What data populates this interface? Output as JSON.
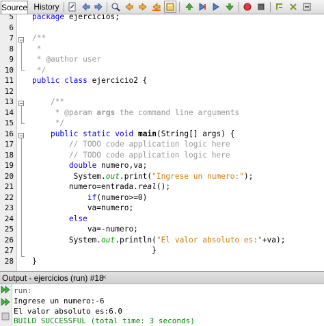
{
  "tabs": {
    "source": "Source",
    "history": "History"
  },
  "toolbar_icons": [
    "last-edit-icon",
    "back-icon",
    "forward-icon",
    "find-prev-icon",
    "find-next-icon",
    "find-selection-icon",
    "toggle-highlight-icon",
    "prev-bookmark-icon",
    "next-bookmark-icon",
    "toggle-bookmark-icon",
    "shift-left-icon",
    "shift-right-icon",
    "record-macro-icon"
  ],
  "editor": {
    "lines": [
      {
        "n": "5",
        "html": "<span class=\"kw\">package</span> ejercicios;"
      },
      {
        "n": "6",
        "html": ""
      },
      {
        "n": "7",
        "html": "<span class=\"cm\">/**</span>"
      },
      {
        "n": "8",
        "html": "<span class=\"cm\"> *</span>"
      },
      {
        "n": "9",
        "html": "<span class=\"cm\"> * @author user</span>"
      },
      {
        "n": "10",
        "html": "<span class=\"cm\"> */</span>"
      },
      {
        "n": "11",
        "html": "<span class=\"kw\">public</span> <span class=\"kw\">class</span> ejercicio2 {"
      },
      {
        "n": "12",
        "html": ""
      },
      {
        "n": "13",
        "html": "    <span class=\"cm\">/**</span>"
      },
      {
        "n": "14",
        "html": "    <span class=\"cm\"> * @param </span><span class=\"cm-b\">args</span><span class=\"cm\"> the command line arguments</span>"
      },
      {
        "n": "15",
        "html": "    <span class=\"cm\"> */</span>"
      },
      {
        "n": "16",
        "html": "    <span class=\"kw\">public</span> <span class=\"kw\">static</span> <span class=\"kw\">void</span> <span class=\"mb\">main</span>(String[] args) {"
      },
      {
        "n": "17",
        "html": "        <span class=\"cm\">// TODO code application logic here</span>"
      },
      {
        "n": "18",
        "html": "        <span class=\"cm\">// TODO code application logic here</span>"
      },
      {
        "n": "19",
        "html": "        <span class=\"kw\">double</span> numero,va;"
      },
      {
        "n": "20",
        "html": "         System.<span class=\"fld\">out</span>.print(<span class=\"str\">\"Ingrese un numero:\"</span>);"
      },
      {
        "n": "21",
        "html": "        numero=entrada.<span class=\"it\">real</span>();"
      },
      {
        "n": "22",
        "html": "            <span class=\"kw\">if</span>(numero&gt;=0)"
      },
      {
        "n": "23",
        "html": "            va=numero;"
      },
      {
        "n": "24",
        "html": "        <span class=\"kw\">else</span>"
      },
      {
        "n": "25",
        "html": "            va=-numero;"
      },
      {
        "n": "26",
        "html": "        System.<span class=\"fld\">out</span>.println(<span class=\"str\">\"El valor absoluto es:\"</span>+va);"
      },
      {
        "n": "27",
        "html": "                          }"
      },
      {
        "n": "28",
        "html": "}"
      }
    ]
  },
  "output": {
    "title": "Output - ejercicios (run) #18",
    "close": "×",
    "lines": [
      {
        "text": "run:",
        "cls": "out-run"
      },
      {
        "text": "Ingrese un numero:-6",
        "cls": ""
      },
      {
        "text": "El valor absoluto es:6.0",
        "cls": ""
      },
      {
        "text": "BUILD SUCCESSFUL (total time: 3 seconds)",
        "cls": "out-ok"
      }
    ]
  }
}
